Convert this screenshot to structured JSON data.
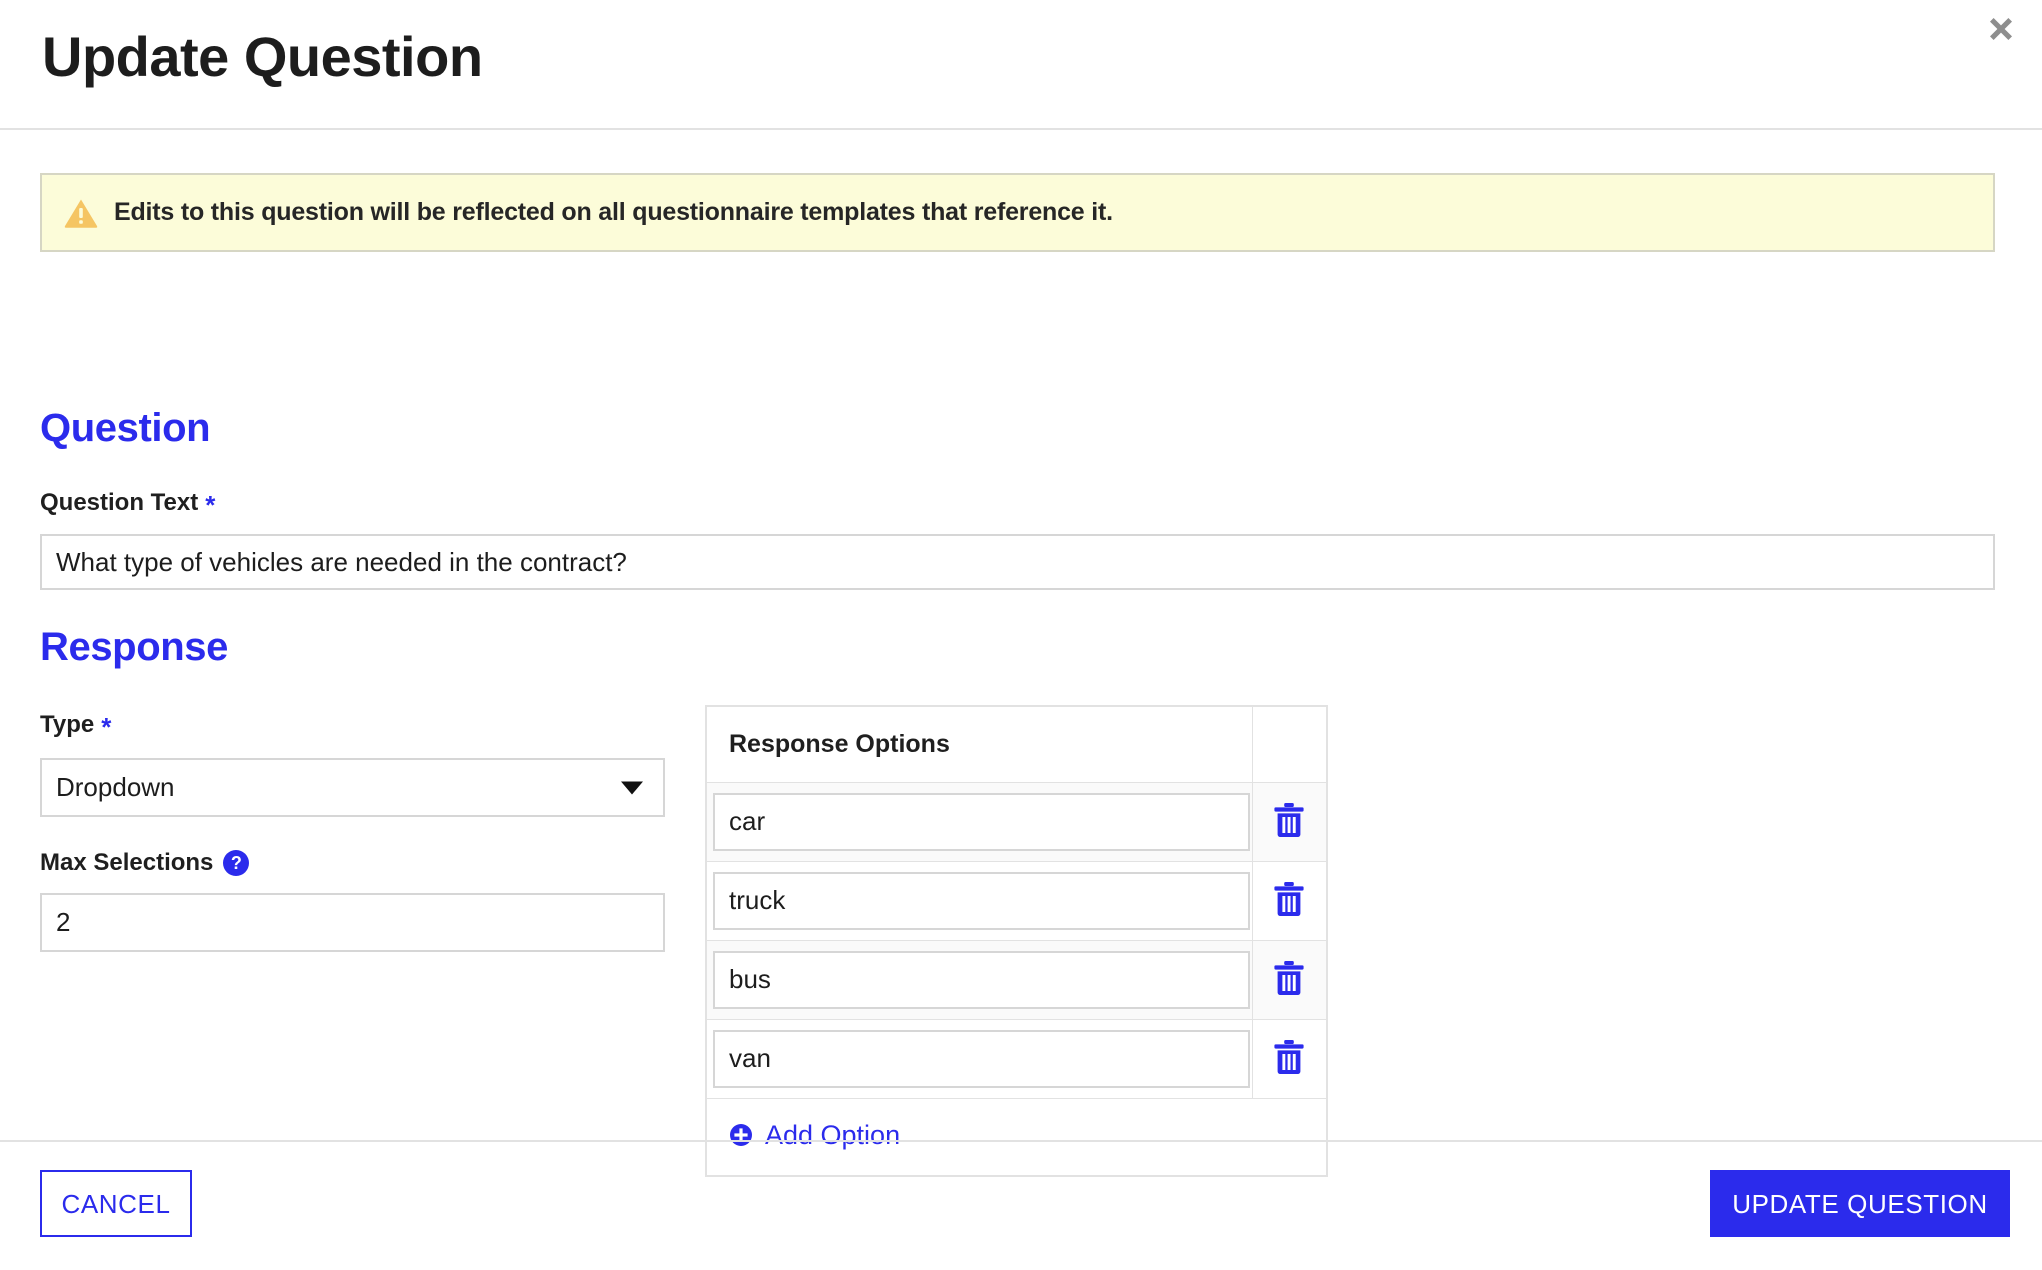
{
  "modal": {
    "title": "Update Question",
    "close_icon": "close-icon"
  },
  "alert": {
    "icon": "warning-triangle-icon",
    "message": "Edits to this question will be reflected on all questionnaire templates that reference it."
  },
  "question_section": {
    "heading": "Question",
    "question_text": {
      "label": "Question Text",
      "required_marker": "*",
      "value": "What type of vehicles are needed in the contract?",
      "placeholder": ""
    }
  },
  "response_section": {
    "heading": "Response",
    "type": {
      "label": "Type",
      "required_marker": "*",
      "selected": "Dropdown",
      "caret_icon": "chevron-down-icon"
    },
    "max_selections": {
      "label": "Max Selections",
      "help_icon": "help-circle-icon",
      "help_glyph": "?",
      "value": "2",
      "placeholder": ""
    },
    "options_table": {
      "header": "Response Options",
      "action_header": "",
      "rows": [
        {
          "value": "car",
          "delete_icon": "trash-icon"
        },
        {
          "value": "truck",
          "delete_icon": "trash-icon"
        },
        {
          "value": "bus",
          "delete_icon": "trash-icon"
        },
        {
          "value": "van",
          "delete_icon": "trash-icon"
        }
      ],
      "add_option": {
        "label": "Add Option",
        "icon": "plus-circle-icon"
      }
    }
  },
  "footer": {
    "cancel_label": "CANCEL",
    "submit_label": "UPDATE QUESTION"
  },
  "colors": {
    "accent_blue": "#2b2bec",
    "alert_background": "#fcfcd9",
    "alert_border": "#d6d6c4",
    "alert_icon": "#f5c563",
    "border_gray": "#e2e2e2",
    "input_border": "#d6d6d6",
    "close_gray": "#8e8e8e",
    "text_dark": "#1d1d1d",
    "row_stripe": "#fafafa"
  }
}
